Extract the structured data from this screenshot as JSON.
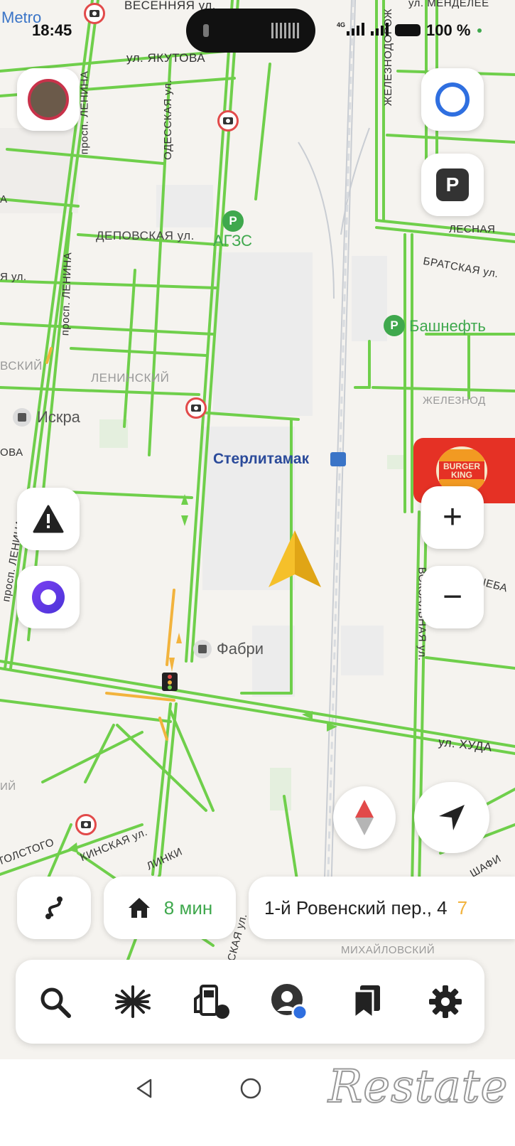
{
  "status_bar": {
    "time": "18:45",
    "network": "4G",
    "battery": "100 %",
    "carrier_label": "Metro"
  },
  "map": {
    "street_labels": {
      "vesennyaya": "ВЕСЕННЯЯ ул.",
      "yakutova": "ул. ЯКУТОВА",
      "odesskaya": "ОДЕССКАЯ ул.",
      "lenina_top": "просп. ЛЕНИНА",
      "lenina_mid": "просп. ЛЕНИНА",
      "lenina_bottom": "просп. ЛЕНИНА",
      "depovskaya": "ДЕПОВСКАЯ ул.",
      "zheleznodor_top": "ЖЕЛЕЗНОДОРОЖ",
      "mendeleev": "ул. МЕНДЕЛЕЕ",
      "lesnaya": "ЛЕСНАЯ",
      "bratskaya": "БРАТСКАЯ ул.",
      "zheleznod": "ЖЕЛЕЗНОД",
      "vokzalnaya": "ВОКЗАЛЬНАЯ ул.",
      "khuda": "ул. ХУДА",
      "tolstogo": "ТОЛСТОГО",
      "kinskaya": "КИНСКАЯ ул.",
      "linki": "ЛИНКИ",
      "skaya": "СКАЯ ул.",
      "mikhailovsky": "МИХАЙЛОВСКИЙ",
      "shafi": "ШАФИ",
      "ulsheba": "УЛЬШЕБА",
      "left_ul": "Я ул.",
      "left_vskiy": "ВСКИЙ",
      "left_ova": "ОВА",
      "left_iy": "ИЙ",
      "left_a": "А"
    },
    "district": "ЛЕНИНСКИЙ",
    "poi": {
      "agzs": "АГЗС",
      "bashneft": "Башнефть",
      "iskra": "Искра",
      "fabri": "Фабри",
      "station": "Стерлитамак"
    },
    "ad": {
      "brand_line1": "BURGER",
      "brand_line2": "KING"
    },
    "colors": {
      "traffic_green": "#6fcf4b",
      "traffic_yellow": "#f2b33d",
      "arrow_yellow": "#f5c02a",
      "camera_red": "#e24a4a"
    }
  },
  "route": {
    "eta": "8 мин",
    "destination": "1-й Ровенский пер., 4",
    "destination_suffix": "7"
  },
  "toolbar": {
    "items": [
      {
        "name": "search-icon",
        "label": "search"
      },
      {
        "name": "overview-icon",
        "label": "overview"
      },
      {
        "name": "fuel-icon",
        "label": "fuel"
      },
      {
        "name": "profile-icon",
        "label": "profile"
      },
      {
        "name": "bookmarks-icon",
        "label": "bookmarks"
      },
      {
        "name": "settings-icon",
        "label": "settings"
      }
    ]
  },
  "watermark": "Restate"
}
